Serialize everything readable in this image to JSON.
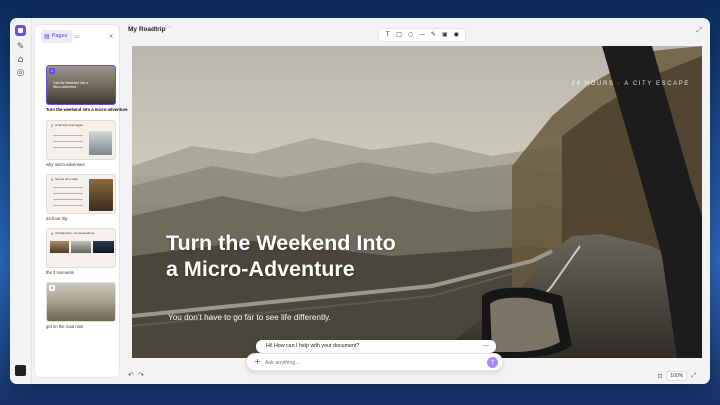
{
  "document": {
    "title": "My Roadtrip"
  },
  "panel": {
    "tab_pages": "Pages",
    "pages": [
      {
        "number": "1",
        "caption": "Turn the weekend into a micro-adventure",
        "mini_title": "Turn the Weekend Into a Micro-Adventure"
      },
      {
        "number": "2",
        "caption": "why micro-adventure",
        "mini_title": "small trips feel bigger"
      },
      {
        "number": "3",
        "caption": "24-hour trip",
        "mini_title": "Simple time table"
      },
      {
        "number": "4",
        "caption": "the 3 moments",
        "mini_title": "Checkpoints, not destinations"
      },
      {
        "number": "5",
        "caption": "get on the road now",
        "mini_title": ""
      }
    ]
  },
  "slide": {
    "tag": "24 HOURS · A CITY ESCAPE",
    "title_line1": "Turn the Weekend Into",
    "title_line2": "a Micro-Adventure",
    "subtitle": "You don’t have to go far to see life differently."
  },
  "zoom": {
    "value": "100%"
  },
  "chat": {
    "greeting": "Hi! How can I help with your document?",
    "placeholder": "Ask anything..."
  },
  "colors": {
    "accent": "#6b4ce0",
    "send": "#a78bfa"
  }
}
